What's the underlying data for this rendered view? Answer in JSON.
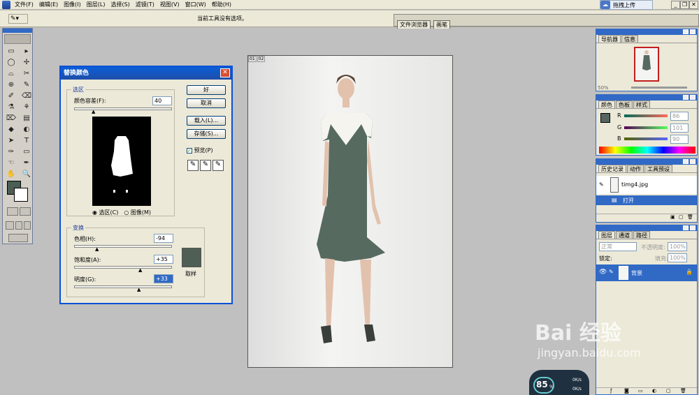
{
  "menu": [
    "文件(F)",
    "编辑(E)",
    "图像(I)",
    "图层(L)",
    "选择(S)",
    "滤镜(T)",
    "视图(V)",
    "窗口(W)",
    "帮助(H)"
  ],
  "upload_label": "拖拽上传",
  "options_bar": {
    "message": "当前工具没有选项。",
    "tool": "✎▾"
  },
  "well_tabs": [
    "文件浏览器",
    "画笔"
  ],
  "toolbox": {
    "tools": [
      "▭",
      "▸",
      "◯",
      "✢",
      "⌓",
      "✂",
      "⊕",
      "✎",
      "✐",
      "⌫",
      "⚗",
      "⚘",
      "⌦",
      "▤",
      "◆",
      "◐",
      "➤",
      "T",
      "✑",
      "▭",
      "☜",
      "✒",
      "✋",
      "🔍"
    ]
  },
  "dialog": {
    "title": "替换颜色",
    "selection_legend": "选区",
    "fuzziness_label": "颜色容差(F):",
    "fuzziness_value": "40",
    "radio_selection": "选区(C)",
    "radio_image": "图像(M)",
    "transform_legend": "变换",
    "hue_label": "色相(H):",
    "hue_value": "-94",
    "saturation_label": "饱和度(A):",
    "saturation_value": "+35",
    "lightness_label": "明度(G):",
    "lightness_value": "+33",
    "sample_label": "取样",
    "sample_color": "#4f5f55",
    "ok": "好",
    "cancel": "取消",
    "load": "载入(L)...",
    "save": "存储(S)...",
    "preview": "预览(P)"
  },
  "document": {
    "tabs": [
      "01",
      "02"
    ],
    "dress_color": "#566a60"
  },
  "navigator": {
    "tabs": [
      "导航器",
      "信息"
    ],
    "zoom": "50%"
  },
  "color_panel": {
    "tabs": [
      "颜色",
      "色板",
      "样式"
    ],
    "r_label": "R",
    "r_value": "86",
    "g_label": "G",
    "g_value": "101",
    "b_label": "B",
    "b_value": "90",
    "fg": "#566560"
  },
  "history": {
    "tabs": [
      "历史记录",
      "动作",
      "工具预设"
    ],
    "snapshot": "timg4.jpg",
    "step": "打开"
  },
  "layers": {
    "tabs": [
      "图层",
      "通道",
      "路径"
    ],
    "mode": "正常",
    "opacity_label": "不透明度:",
    "opacity": "100%",
    "lock_label": "锁定:",
    "fill_label": "填充:",
    "fill": "100%",
    "layer_name": "背景"
  },
  "watermark": {
    "logo": "Bai 经验",
    "url": "jingyan.baidu.com"
  },
  "hud": {
    "percent": "85",
    "unit": "%",
    "up": "0K/s",
    "down": "0K/s"
  }
}
